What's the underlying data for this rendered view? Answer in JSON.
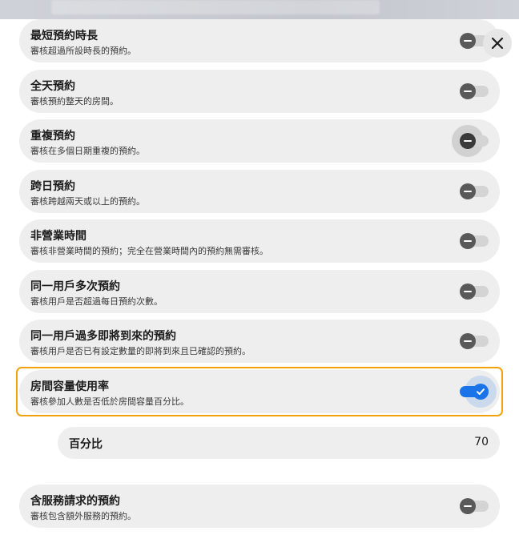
{
  "backdrop": {
    "text": "",
    "label": ""
  },
  "colors": {
    "accent": "#1a73e8",
    "highlight_border": "#f2a20c",
    "row_background": "#eeeeee",
    "knob_off": "#595959"
  },
  "icons": {
    "close": "close-icon",
    "toggle_off": "minus-icon",
    "toggle_on": "check-icon"
  },
  "rules": [
    {
      "title": "最短預約時長",
      "desc": "審核超過所設時長的預約。",
      "enabled": false
    },
    {
      "title": "全天預約",
      "desc": "審核預約整天的房間。",
      "enabled": false
    },
    {
      "title": "重複預約",
      "desc": "審核在多個日期重複的預約。",
      "enabled": false,
      "hovered": true
    },
    {
      "title": "跨日預約",
      "desc": "審核跨越兩天或以上的預約。",
      "enabled": false
    },
    {
      "title": "非營業時間",
      "desc": "審核非營業時間的預約；完全在營業時間內的預約無需審核。",
      "enabled": false
    },
    {
      "title": "同一用戶多次預約",
      "desc": "審核用戶是否超過每日預約次數。",
      "enabled": false
    },
    {
      "title": "同一用戶過多即將到來的預約",
      "desc": "審核用戶是否已有設定數量的即將到來且已確認的預約。",
      "enabled": false
    },
    {
      "title": "房間容量使用率",
      "desc": "審核參加人數是否低於房間容量百分比。",
      "enabled": true,
      "focused": true
    },
    {
      "title": "含服務請求的預約",
      "desc": "審核包含額外服務的預約。",
      "enabled": false
    }
  ],
  "percentage": {
    "label": "百分比",
    "value": "70"
  }
}
